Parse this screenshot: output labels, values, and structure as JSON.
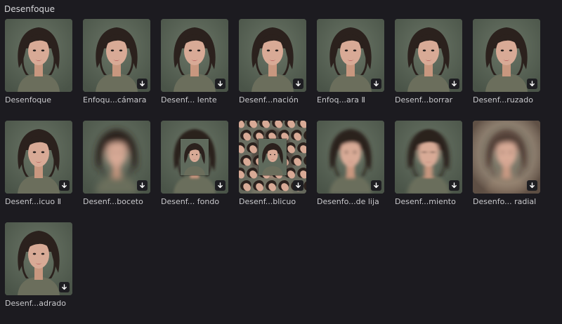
{
  "section": {
    "title": "Desenfoque"
  },
  "tiles": [
    {
      "label": "Desenfoque",
      "effect": "none",
      "downloadable": false
    },
    {
      "label": "Enfoqu...cámara",
      "effect": "none",
      "downloadable": true
    },
    {
      "label": "Desenf... lente",
      "effect": "none",
      "downloadable": true
    },
    {
      "label": "Desenf...nación",
      "effect": "none",
      "downloadable": true
    },
    {
      "label": "Enfoq...ara Ⅱ",
      "effect": "none",
      "downloadable": true
    },
    {
      "label": "Desenf...borrar",
      "effect": "none",
      "downloadable": true
    },
    {
      "label": "Desenf...ruzado",
      "effect": "none",
      "downloadable": true
    },
    {
      "label": "Desenf...icuo Ⅱ",
      "effect": "none",
      "downloadable": true
    },
    {
      "label": "Desenf...boceto",
      "effect": "blur-strong",
      "downloadable": true
    },
    {
      "label": "Desenf... fondo",
      "effect": "background",
      "downloadable": true
    },
    {
      "label": "Desenf...blicuo",
      "effect": "oblique-pattern",
      "downloadable": true
    },
    {
      "label": "Desenfo...de lija",
      "effect": "blur-light",
      "downloadable": true
    },
    {
      "label": "Desenf...miento",
      "effect": "motion",
      "downloadable": true
    },
    {
      "label": "Desenfo... radial",
      "effect": "radial",
      "downloadable": true
    },
    {
      "label": "Desenf...adrado",
      "effect": "none",
      "downloadable": true
    }
  ],
  "colors": {
    "background": "#1c1b20",
    "thumb_bg": "#5b6658",
    "hair": "#2b211d",
    "skin": "#d8aa96",
    "shirt": "#6b6e5c",
    "lips": "#b45a5a",
    "badge": "#1e1e22"
  },
  "icons": {
    "download": "download-arrow-icon"
  }
}
